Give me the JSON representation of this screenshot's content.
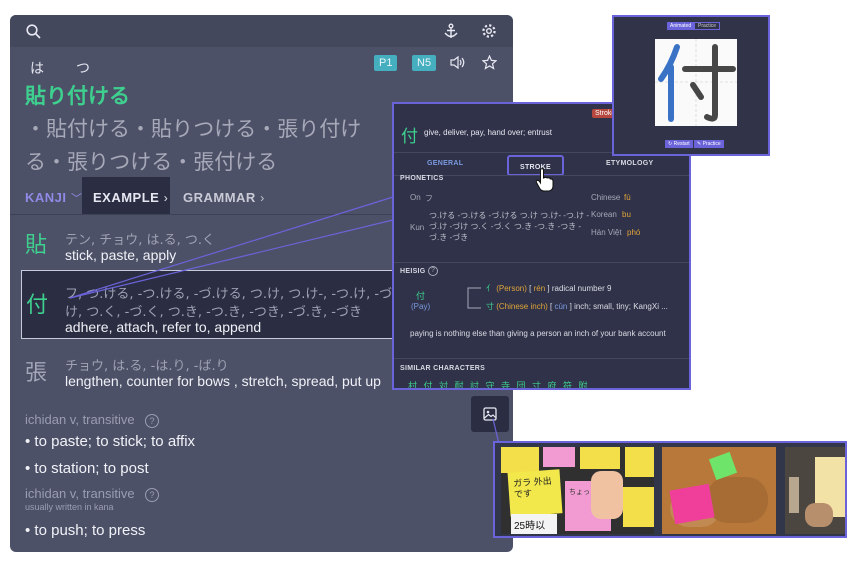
{
  "header": {
    "furigana": [
      "は",
      "つ"
    ],
    "word": "貼り付ける",
    "badges": [
      "P1",
      "N5"
    ],
    "alternates": "・貼付ける・貼りつける・張り付ける・張りつける・張付ける"
  },
  "tabs": {
    "kanji": "KANJI",
    "example": "EXAMPLE",
    "grammar": "GRAMMAR"
  },
  "kanji_list": [
    {
      "char": "貼",
      "readings": "テン, チョウ, は.る, つ.く",
      "meaning": "stick, paste, apply"
    },
    {
      "char": "付",
      "readings1": "フ, つ.ける, -つ.ける, -づ.ける, つ.け, つ.け-, -つ.け, -づ.け",
      "readings2": "け, つ.く, -づ.く, つ.き, -つ.き, -つき, -づ.き, -づき",
      "meaning": "adhere, attach, refer to, append"
    },
    {
      "char": "張",
      "readings": "チョウ, は.る, -は.り, -ば.り",
      "meaning": "lengthen, counter for bows , stretch, spread, put up"
    }
  ],
  "senses": [
    {
      "pos": "ichidan v, transitive",
      "defs": [
        "to paste; to stick; to affix",
        "to station; to post"
      ]
    },
    {
      "pos": "ichidan v, transitive",
      "note": "usually written in kana",
      "defs": [
        "to push; to press"
      ]
    }
  ],
  "popup": {
    "stroke_tag": "Stroke",
    "kanji": "付",
    "gloss": "give, deliver, pay, hand over; entrust",
    "tabs": [
      "GENERAL",
      "STROKE",
      "ETYMOLOGY"
    ],
    "phonetics_label": "PHONETICS",
    "on_label": "On",
    "on_value": "フ",
    "kun_label": "Kun",
    "kun_value": "つ.ける -つ.ける -づ.ける つ.け つ.け- -つ.け -づ.け -づけ つ.く -づ.く つ.き -つ.き -つき -づ.き -づき",
    "chinese_label": "Chinese",
    "chinese_value": "fù",
    "korean_label": "Korean",
    "korean_value": "bu",
    "hanviet_label": "Hán Việt",
    "hanviet_value": "phó",
    "heisig_label": "HEISIG",
    "heisig_kanji": "付",
    "heisig_keyword": "(Pay)",
    "comp1_char": "亻",
    "comp1_name": "(Person)",
    "comp1_reading": "rén",
    "comp1_text": "radical number 9",
    "comp2_char": "寸",
    "comp2_name": "(Chinese inch)",
    "comp2_reading": "cùn",
    "comp2_text": "inch; small, tiny; KangXi ...",
    "story": "paying is nothing else than giving a person an inch of your bank account",
    "similar_label": "SIMILAR CHARACTERS",
    "similar": "村 付 対 耐 討 守 寺 団 寸 府 符 附"
  },
  "kanji_image": {
    "modes": [
      "Animated",
      "Practice"
    ],
    "glyph": "付",
    "buttons": [
      "↻ Restart",
      "✎ Practice"
    ]
  },
  "photo_notes": [
    "ガラ 外出です",
    "25時以",
    "ちょっと"
  ],
  "colors": {
    "accent": "#6b63d9",
    "green": "#3ed08e",
    "teal": "#45aebf",
    "orange": "#e0a43a"
  }
}
